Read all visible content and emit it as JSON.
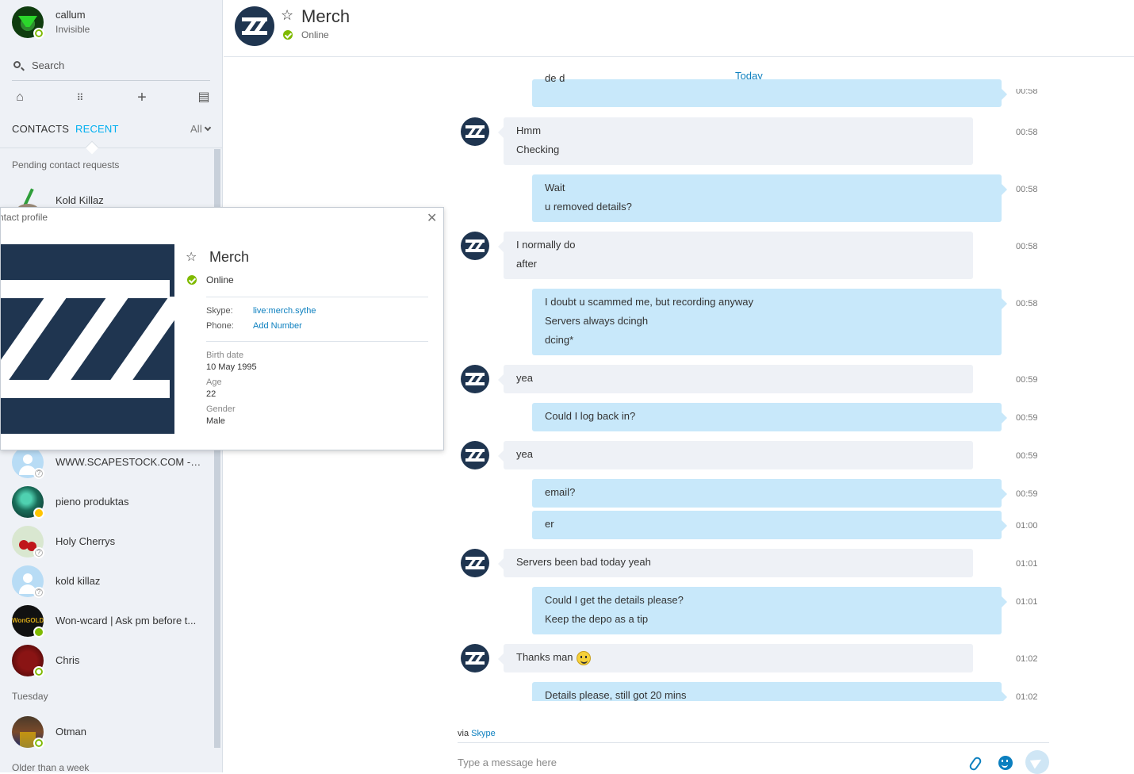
{
  "me": {
    "name": "callum",
    "status": "Invisible"
  },
  "search": {
    "label": "Search"
  },
  "toolbar": {
    "icons": [
      "home-icon",
      "dialpad-icon",
      "add-icon",
      "contacts-book-icon"
    ]
  },
  "tabs": {
    "contacts": "CONTACTS",
    "recent": "RECENT",
    "filter": "All"
  },
  "sidebar": {
    "pending_label": "Pending contact requests",
    "pending": [
      {
        "name": "Kold Killaz"
      }
    ],
    "recent": [
      {
        "name": "WWW.SCAPESTOCK.COM -RS...",
        "status": "unknown"
      },
      {
        "name": "pieno produktas",
        "status": "away"
      },
      {
        "name": "Holy Cherrys",
        "status": "unknown"
      },
      {
        "name": "kold killaz",
        "status": "unknown"
      },
      {
        "name": "Won-wcard | Ask pm before t...",
        "status": "online"
      },
      {
        "name": "Chris",
        "status": "invisible"
      }
    ],
    "tuesday_label": "Tuesday",
    "tuesday": [
      {
        "name": "Otman",
        "status": "invisible"
      }
    ],
    "older_label": "Older than a week"
  },
  "header": {
    "title": "Merch",
    "status": "Online"
  },
  "chat": {
    "day": "Today",
    "partial_top": {
      "text": "de d",
      "time": "00:58"
    },
    "messages": [
      {
        "dir": "in",
        "lines": [
          "Hmm",
          "Checking"
        ],
        "time": "00:58"
      },
      {
        "dir": "out",
        "lines": [
          "Wait",
          "u removed details?"
        ],
        "time": "00:58"
      },
      {
        "dir": "in",
        "lines": [
          "I normally do",
          "after"
        ],
        "time": "00:58"
      },
      {
        "dir": "out",
        "lines": [
          "I doubt u scammed me, but recording anyway",
          "Servers always dcingh",
          "dcing*"
        ],
        "time": "00:58"
      },
      {
        "dir": "in",
        "lines": [
          "yea"
        ],
        "time": "00:59"
      },
      {
        "dir": "out",
        "lines": [
          "Could I log back in?"
        ],
        "time": "00:59"
      },
      {
        "dir": "in",
        "lines": [
          "yea"
        ],
        "time": "00:59"
      },
      {
        "dir": "out",
        "lines": [
          "email?"
        ],
        "time": "00:59"
      },
      {
        "dir": "out",
        "lines": [
          "er"
        ],
        "time": "01:00"
      },
      {
        "dir": "in",
        "lines": [
          "Servers been bad today yeah"
        ],
        "time": "01:01"
      },
      {
        "dir": "out",
        "lines": [
          "Could I get the details please?",
          "Keep the depo as a tip"
        ],
        "time": "01:01"
      },
      {
        "dir": "in",
        "lines": [
          "Thanks man"
        ],
        "emoji": "smiley-icon",
        "time": "01:02"
      },
      {
        "dir": "out",
        "lines": [
          "Details please, still got 20 mins"
        ],
        "time": "01:02"
      }
    ]
  },
  "footer": {
    "via": "via",
    "via_link": "Skype",
    "placeholder": "Type a message here"
  },
  "profile": {
    "title": "ntact profile",
    "name": "Merch",
    "status": "Online",
    "skype_label": "Skype:",
    "skype_value": "live:merch.sythe",
    "phone_label": "Phone:",
    "phone_value": "Add Number",
    "birth_label": "Birth date",
    "birth_value": "10 May 1995",
    "age_label": "Age",
    "age_value": "22",
    "gender_label": "Gender",
    "gender_value": "Male"
  },
  "colors": {
    "accent": "#00aff0",
    "link": "#0b7fbf",
    "bubble_out": "#c8e8fa",
    "bubble_in": "#eef1f6",
    "online": "#7fba00",
    "away": "#ffc500",
    "brand_dark": "#1f3550"
  }
}
